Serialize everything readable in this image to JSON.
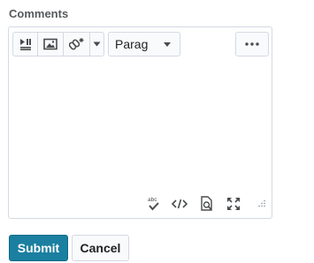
{
  "form": {
    "heading": "Comments",
    "submit_label": "Submit",
    "cancel_label": "Cancel"
  },
  "editor": {
    "toolbar": {
      "buttons": [
        {
          "name": "insert-stuff",
          "icon": "media-play-list-icon"
        },
        {
          "name": "insert-image",
          "icon": "image-icon"
        },
        {
          "name": "insert-quicklink",
          "icon": "link-sparkle-icon"
        },
        {
          "name": "more-insert-options",
          "icon": "chevron-down-icon"
        }
      ],
      "format_select": {
        "value": "Parag"
      },
      "more_actions": {
        "icon": "ellipsis-icon"
      }
    },
    "content_value": "",
    "status_bar": [
      {
        "name": "spellcheck",
        "icon": "abc-check-icon",
        "text": "abc"
      },
      {
        "name": "source-code",
        "icon": "code-icon",
        "text": "</>"
      },
      {
        "name": "preview",
        "icon": "preview-icon"
      },
      {
        "name": "fullscreen",
        "icon": "expand-icon"
      },
      {
        "name": "resize",
        "icon": "resize-grip-icon"
      }
    ],
    "colors": {
      "border": "#d3d9e3",
      "toolbar_bg": "#f9fafb",
      "icon": "#494c4e",
      "primary": "#1a7fa0"
    }
  }
}
